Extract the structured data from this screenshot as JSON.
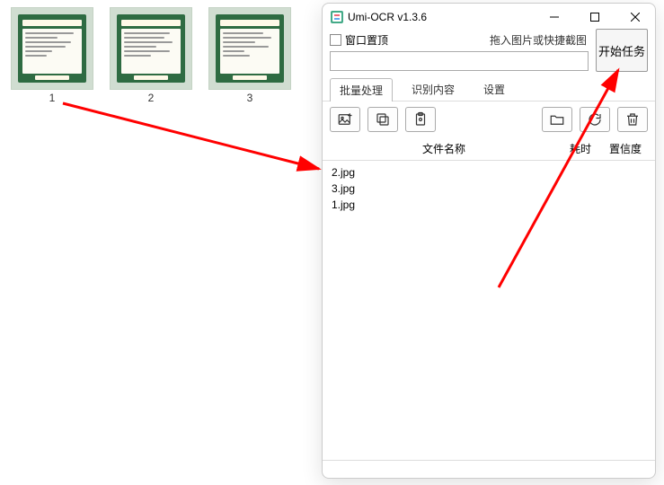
{
  "desktop": {
    "thumbs": [
      {
        "label": "1"
      },
      {
        "label": "2"
      },
      {
        "label": "3"
      }
    ]
  },
  "window": {
    "title": "Umi-OCR v1.3.6",
    "pin_checkbox": "窗口置顶",
    "hint": "拖入图片或快捷截图",
    "start_btn": "开始任务",
    "tabs": {
      "batch": "批量处理",
      "result": "识别内容",
      "settings": "设置"
    },
    "table_headers": {
      "name": "文件名称",
      "time": "耗时",
      "conf": "置信度"
    },
    "files": [
      "2.jpg",
      "3.jpg",
      "1.jpg"
    ],
    "status": ""
  },
  "icons": {
    "image_add": "image-add-icon",
    "copy": "copy-icon",
    "clipboard_image": "clipboard-image-icon",
    "folder": "folder-icon",
    "refresh": "refresh-icon",
    "trash": "trash-icon"
  }
}
